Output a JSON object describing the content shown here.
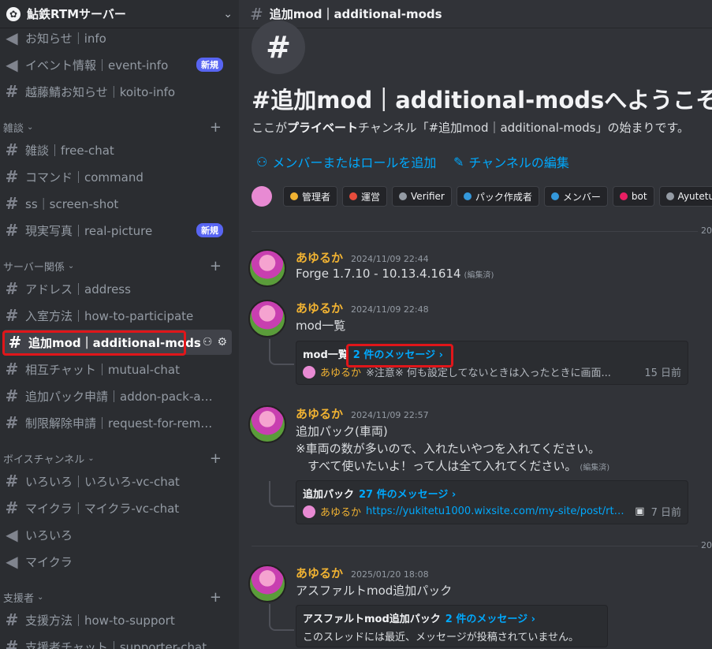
{
  "server": {
    "name": "鮎鉄RTMサーバー",
    "icon": "gear-icon"
  },
  "sidebar": {
    "channels_top": [
      {
        "label": "お知らせ｜info",
        "icon": "megaphone-icon"
      },
      {
        "label": "イベント情報｜event-info",
        "icon": "megaphone-icon",
        "badge": "新規"
      },
      {
        "label": "越藤鯖お知らせ｜koito-info",
        "icon": "hash-icon"
      }
    ],
    "categories": [
      {
        "label": "雑談",
        "channels": [
          {
            "label": "雑談｜free-chat"
          },
          {
            "label": "コマンド｜command"
          },
          {
            "label": "ss｜screen-shot"
          },
          {
            "label": "現実写真｜real-picture",
            "badge": "新規"
          }
        ]
      },
      {
        "label": "サーバー関係",
        "channels": [
          {
            "label": "アドレス｜address"
          },
          {
            "label": "入室方法｜how-to-participate"
          },
          {
            "label": "追加mod｜additional-mods"
          },
          {
            "label": "相互チャット｜mutual-chat"
          },
          {
            "label": "追加パック申請｜addon-pack-ap..."
          },
          {
            "label": "制限解除申請｜request-for-remo..."
          }
        ]
      },
      {
        "label": "ボイスチャンネル",
        "channels": [
          {
            "label": "いろいろ｜いろいろ-vc-chat"
          },
          {
            "label": "マイクラ｜マイクラ-vc-chat"
          },
          {
            "label": "いろいろ"
          },
          {
            "label": "マイクラ"
          }
        ]
      },
      {
        "label": "支援者",
        "channels": [
          {
            "label": "支援方法｜how-to-support"
          },
          {
            "label": "支援者チャット｜supporter-chat"
          }
        ]
      }
    ]
  },
  "main": {
    "channel_title": "追加mod｜additional-mods",
    "welcome_title": "#追加mod｜additional-modsへようこそ",
    "welcome_sub_pre": "ここが",
    "welcome_sub_bold": "プライベート",
    "welcome_sub_post": "チャンネル「#追加mod｜additional-mods」の始まりです。",
    "add_members": "メンバーまたはロールを追加",
    "edit_channel": "チャンネルの編集",
    "roles": [
      {
        "name": "管理者",
        "color": "#f0b232"
      },
      {
        "name": "運営",
        "color": "#e74c3c"
      },
      {
        "name": "Verifier",
        "color": "#949ba4"
      },
      {
        "name": "パック作成者",
        "color": "#3498db"
      },
      {
        "name": "メンバー",
        "color": "#3498db"
      },
      {
        "name": "bot",
        "color": "#e91e63"
      },
      {
        "name": "Ayutetu",
        "color": "#949ba4"
      }
    ],
    "date_divider_1": "20",
    "date_divider_2": "20",
    "messages": [
      {
        "user": "あゆるか",
        "time": "2024/11/09 22:44",
        "text": "Forge 1.7.10 - 10.13.4.1614",
        "edited": "(編集済)"
      },
      {
        "user": "あゆるか",
        "time": "2024/11/09 22:48",
        "text": "mod一覧",
        "thread": {
          "name": "mod一覧",
          "count": "2 件のメッセージ ›",
          "last_user": "あゆるか",
          "preview": "※注意※ 何も設定してないときは入ったときに画面...",
          "ago": "15 日前"
        }
      },
      {
        "user": "あゆるか",
        "time": "2024/11/09 22:57",
        "text": "追加パック(車両)",
        "text2": "※車両の数が多いので、入れたいやつを入れてください。",
        "text3": "　すべて使いたいよ！って人は全て入れてください。",
        "edited": "(編集済)",
        "thread": {
          "name": "追加パック",
          "count": "27 件のメッセージ ›",
          "last_user": "あゆるか",
          "preview": "https://yukitetu1000.wixsite.com/my-site/post/rtm-...",
          "ago": "7 日前"
        }
      },
      {
        "user": "あゆるか",
        "time": "2025/01/20 18:08",
        "text": "アスファルトmod追加パック",
        "thread": {
          "name": "アスファルトmod追加パック",
          "count": "2 件のメッセージ ›",
          "empty": "このスレッドには最近、メッセージが投稿されていません。"
        }
      }
    ]
  },
  "colors": {
    "highlight": "#e0161a",
    "accent": "#5865f2",
    "link": "#00a8fc",
    "username": "#f0b232"
  }
}
